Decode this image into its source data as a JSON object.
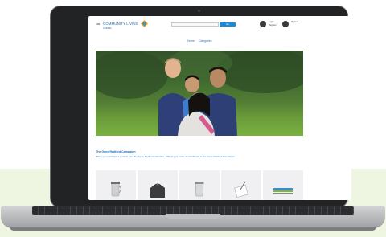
{
  "site": {
    "logo_text": "COMMUNITY LIVING",
    "logo_sub": "Ontario",
    "menu_icon": "hamburger-icon",
    "search_button": "Go",
    "account": {
      "line1": "Login",
      "line2": "Register",
      "icon": "user-icon"
    },
    "cart": {
      "label": "My Cart",
      "icon": "cart-icon"
    }
  },
  "nav": {
    "home": "Home",
    "categories": "Categories"
  },
  "hero": {
    "image": "family-photo-outdoors"
  },
  "promo": {
    "title": "The Gene Radford Campaign",
    "text": "When you purchase a product from the Gene Radford collection, 10% of your order is contributed to the Gene Radford Foundation."
  },
  "products": [
    {
      "icon": "travel-mug-icon"
    },
    {
      "icon": "backpack-icon"
    },
    {
      "icon": "tumbler-icon"
    },
    {
      "icon": "notebook-pen-icon"
    },
    {
      "icon": "lanyard-icon"
    }
  ],
  "colors": {
    "brand_blue": "#1e6fb8",
    "button_blue": "#1b8bd6",
    "background_green": "#eef6e2"
  }
}
